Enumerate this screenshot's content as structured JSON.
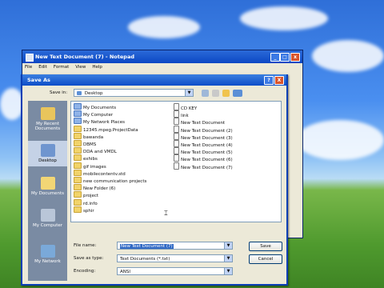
{
  "notepad": {
    "title": "New Text Document (7) - Notepad",
    "menu": [
      "File",
      "Edit",
      "Format",
      "View",
      "Help"
    ]
  },
  "dialog": {
    "title": "Save As",
    "help_button": "?",
    "close_button": "X",
    "save_in_label": "Save in:",
    "save_in_value": "Desktop"
  },
  "places": [
    {
      "label": "My Recent Documents",
      "icon": "recent-documents-icon"
    },
    {
      "label": "Desktop",
      "icon": "desktop-icon"
    },
    {
      "label": "My Documents",
      "icon": "my-documents-icon"
    },
    {
      "label": "My Computer",
      "icon": "my-computer-icon"
    },
    {
      "label": "My Network",
      "icon": "my-network-icon"
    }
  ],
  "files_left": [
    {
      "name": "My Documents",
      "type": "special"
    },
    {
      "name": "My Computer",
      "type": "special"
    },
    {
      "name": "My Network Places",
      "type": "special"
    },
    {
      "name": "12345.mpeg.ProjectData",
      "type": "folder"
    },
    {
      "name": "bawanda",
      "type": "folder"
    },
    {
      "name": "DBMS",
      "type": "folder"
    },
    {
      "name": "DDA and VMDL",
      "type": "folder"
    },
    {
      "name": "exhibs",
      "type": "folder"
    },
    {
      "name": "gif images",
      "type": "folder"
    },
    {
      "name": "mobilecontentv.std",
      "type": "folder"
    },
    {
      "name": "new communication projects",
      "type": "folder"
    },
    {
      "name": "New Folder (6)",
      "type": "folder"
    },
    {
      "name": "project",
      "type": "folder"
    },
    {
      "name": "rd.info",
      "type": "folder"
    },
    {
      "name": "sphir",
      "type": "folder"
    }
  ],
  "files_right": [
    {
      "name": "CD KEY",
      "type": "doc"
    },
    {
      "name": "link",
      "type": "doc"
    },
    {
      "name": "New Text Document",
      "type": "doc"
    },
    {
      "name": "New Text Document (2)",
      "type": "doc"
    },
    {
      "name": "New Text Document (3)",
      "type": "doc"
    },
    {
      "name": "New Text Document (4)",
      "type": "doc"
    },
    {
      "name": "New Text Document (5)",
      "type": "doc"
    },
    {
      "name": "New Text Document (6)",
      "type": "doc"
    },
    {
      "name": "New Text Document (7)",
      "type": "doc"
    }
  ],
  "form": {
    "filename_label": "File name:",
    "filename_value": "New Text Document (7)",
    "savetype_label": "Save as type:",
    "savetype_value": "Text Documents (*.txt)",
    "encoding_label": "Encoding:",
    "encoding_value": "ANSI",
    "save_button": "Save",
    "cancel_button": "Cancel"
  }
}
